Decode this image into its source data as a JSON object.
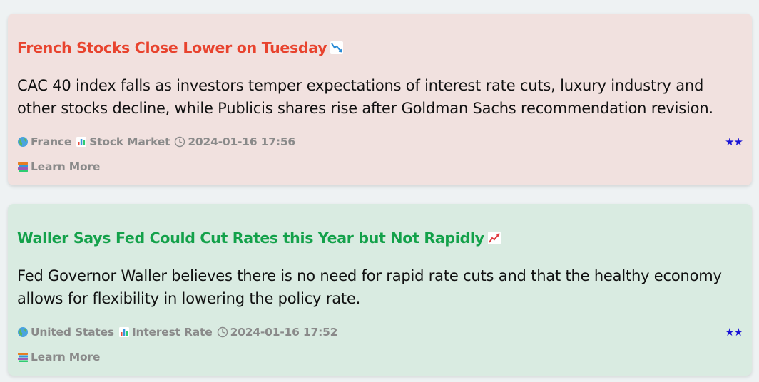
{
  "colors": {
    "page_background": "#eef2f3",
    "negative_card_background": "#f1e1df",
    "positive_card_background": "#d9ebe1",
    "negative_title": "#e8432e",
    "positive_title": "#13a14a",
    "meta_text": "#8a8a8a",
    "stars": "#1a14d6"
  },
  "articles": [
    {
      "sentiment": "negative",
      "title": "French Stocks Close Lower on Tuesday",
      "title_icon": "chart-decreasing-icon",
      "summary": "CAC 40 index falls as investors temper expectations of interest rate cuts, luxury industry and other stocks decline, while Publicis shares rise after Goldman Sachs recommendation revision.",
      "region_icon": "globe-icon",
      "region": "France",
      "category_icon": "bar-chart-icon",
      "category": "Stock Market",
      "time_icon": "clock-icon",
      "timestamp": "2024-01-16 17:56",
      "rating": "★★",
      "learn_more_icon": "books-icon",
      "learn_more": "Learn More"
    },
    {
      "sentiment": "positive",
      "title": "Waller Says Fed Could Cut Rates this Year but Not Rapidly",
      "title_icon": "chart-increasing-icon",
      "summary": "Fed Governor Waller believes there is no need for rapid rate cuts and that the healthy economy allows for flexibility in lowering the policy rate.",
      "region_icon": "globe-icon",
      "region": "United States",
      "category_icon": "bar-chart-icon",
      "category": "Interest Rate",
      "time_icon": "clock-icon",
      "timestamp": "2024-01-16 17:52",
      "rating": "★★",
      "learn_more_icon": "books-icon",
      "learn_more": "Learn More"
    }
  ]
}
